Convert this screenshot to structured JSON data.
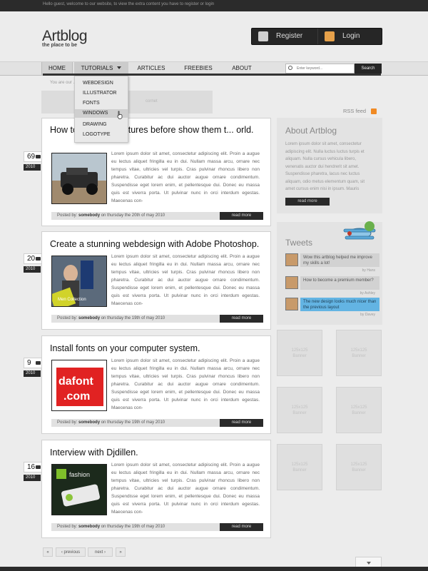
{
  "topbar": {
    "text": "Hello guest, welcome to our website, to view the extra content you have to register or login"
  },
  "logo": {
    "title": "Artblog",
    "tagline": "the place to be"
  },
  "userbox": {
    "register": "Register",
    "login": "Login"
  },
  "nav": {
    "home": "HOME",
    "tutorials": "TUTORIALS",
    "articles": "ARTICLES",
    "freebies": "FREEBIES",
    "about": "ABOUT"
  },
  "search": {
    "placeholder": "Enter keyword...",
    "button": "Search"
  },
  "breadcrumb": "You are our ... ng.nl ▸ homepage",
  "gray_block_text": "cornet",
  "dropdown": {
    "items": [
      "WEBDESIGN",
      "ILLUSTRATOR",
      "FONTS",
      "WINDOWS",
      "DRAWING",
      "LOGOTYPE"
    ],
    "active_index": 3
  },
  "rss": "RSS feed",
  "posts": [
    {
      "title": "How to ... s your pictures before show them t... orld.",
      "day": "69",
      "year": "2010",
      "text": "Lorem ipsum dolor sit amet, consectetur adipiscing elit. Proin a augue eu lectus aliquet fringilla eu in dui. Nullam massa arcu, ornare nec tempus vitae, ultricies vel turpis. Cras pulvinar rhoncus libero non pharetra. Curabitur ac dui auctor augue ornare condimentum. Suspendisse eget lorem enim, et pellentesque dui. Donec eu massa quis est viverra porta. Ut pulvinar nunc in orci interdum egestas. Maecenas con-",
      "posted_by": "Posted by:",
      "author": "somebody",
      "date": "on thursday the 20th of may 2010",
      "read_more": "read more"
    },
    {
      "title": "Create a stunning webdesign with Adobe Photoshop.",
      "day": "20",
      "year": "2010",
      "text": "Lorem ipsum dolor sit amet, consectetur adipiscing elit. Proin a augue eu lectus aliquet fringilla eu in dui. Nullam massa arcu, ornare nec tempus vitae, ultricies vel turpis. Cras pulvinar rhoncus libero non pharetra. Curabitur ac dui auctor augue ornare condimentum. Suspendisse eget lorem enim, et pellentesque dui. Donec eu massa quis est viverra porta. Ut pulvinar nunc in orci interdum egestas. Maecenas con-",
      "posted_by": "Posted by:",
      "author": "somebody",
      "date": "on thursday the 19th of may 2010",
      "read_more": "read more",
      "thumb_label": "Men Collection"
    },
    {
      "title": "Install fonts on your computer system.",
      "day": "9",
      "year": "2010",
      "text": "Lorem ipsum dolor sit amet, consectetur adipiscing elit. Proin a augue eu lectus aliquet fringilla eu in dui. Nullam massa arcu, ornare nec tempus vitae, ultricies vel turpis. Cras pulvinar rhoncus libero non pharetra. Curabitur ac dui auctor augue ornare condimentum. Suspendisse eget lorem enim, et pellentesque dui. Donec eu massa quis est viverra porta. Ut pulvinar nunc in orci interdum egestas. Maecenas con-",
      "posted_by": "Posted by:",
      "author": "somebody",
      "date": "on thursday the 19th of may 2010",
      "read_more": "read more",
      "thumb_line1": "dafont",
      "thumb_line2": ".com"
    },
    {
      "title": "Interview with Djdillen.",
      "day": "16",
      "year": "2010",
      "text": "Lorem ipsum dolor sit amet, consectetur adipiscing elit. Proin a augue eu lectus aliquet fringilla eu in dui. Nullam massa arcu, ornare nec tempus vitae, ultricies vel turpis. Cras pulvinar rhoncus libero non pharetra. Curabitur ac dui auctor augue ornare condimentum. Suspendisse eget lorem enim, et pellentesque dui. Donec eu massa quis est viverra porta. Ut pulvinar nunc in orci interdum egestas. Maecenas con-",
      "posted_by": "Posted by:",
      "author": "somebody",
      "date": "on thursday the 19th of may 2010",
      "read_more": "read more",
      "thumb_label": "fashion"
    }
  ],
  "about": {
    "title": "About Artblog",
    "text": "Lorem ipsum dolor sit amet, consectetur adipiscing elit. Nulla luctus luctus turpis et aliquam. Nulla cursus vehicula libero, venenatis auctor dui hendrerit sit amet. Suspendisse pharetra, lacus nec luctus aliquam, odio metus elementum quam, sit amet cursus enim nisi in ipsum. Mauris",
    "button": "read more"
  },
  "tweets": {
    "title": "Tweets",
    "items": [
      {
        "text": "Wow this artblog helped me improve my skills a lot!",
        "by": "by Hans"
      },
      {
        "text": "How to become a premium member?",
        "by": "by Ashley"
      },
      {
        "text": "The new design looks much nicer than the previous layout",
        "by": "by Davey"
      }
    ]
  },
  "banners": {
    "size": "125x125",
    "label": "Banner"
  },
  "pagination": {
    "first": "«",
    "previous": "‹ previous",
    "next": "next ›",
    "last": "»"
  },
  "colors": {
    "accent": "#2a2a2a",
    "tweet_highlight": "#63b4e3",
    "rss": "#f08a24"
  }
}
